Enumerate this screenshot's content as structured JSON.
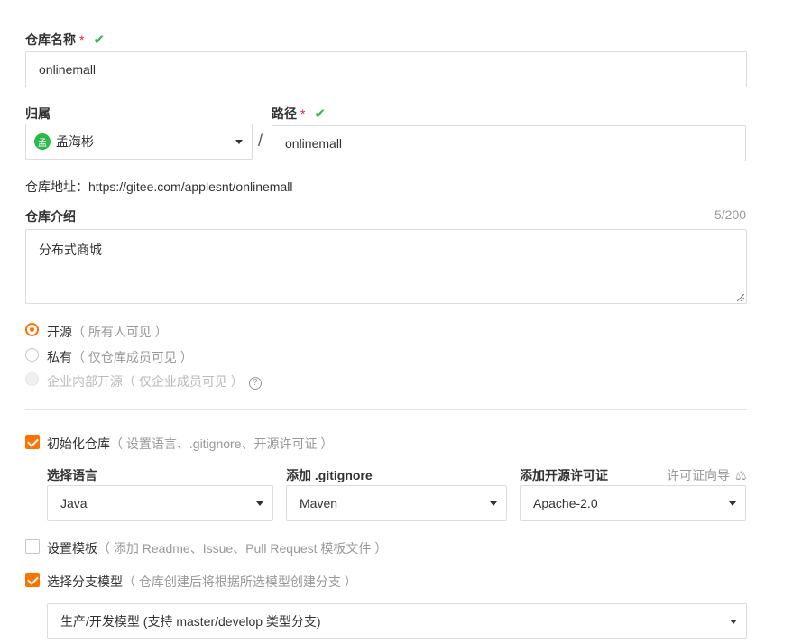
{
  "repo_name": {
    "label": "仓库名称",
    "required_mark": "*",
    "check_glyph": "✔",
    "value": "onlinemall"
  },
  "owner": {
    "label": "归属",
    "avatar_text": "孟",
    "value": "孟海彬"
  },
  "slash": "/",
  "path": {
    "label": "路径",
    "required_mark": "*",
    "check_glyph": "✔",
    "value": "onlinemall"
  },
  "repo_address": "仓库地址：https://gitee.com/applesnt/onlinemall",
  "description": {
    "label": "仓库介绍",
    "counter": "5/200",
    "value": "分布式商城"
  },
  "visibility": {
    "options": [
      {
        "label": "开源",
        "hint": "（ 所有人可见 ）",
        "checked": true
      },
      {
        "label": "私有",
        "hint": "（ 仅仓库成员可见 ）",
        "checked": false
      },
      {
        "label": "企业内部开源",
        "hint": "（ 仅企业成员可见 ）",
        "disabled": true
      }
    ],
    "help_icon": "question-circle-icon",
    "help_glyph": "?"
  },
  "init_repo": {
    "label": "初始化仓库",
    "hint": "（ 设置语言、.gitignore、开源许可证 ）",
    "checked": true
  },
  "language": {
    "label": "选择语言",
    "value": "Java"
  },
  "gitignore": {
    "label": "添加 .gitignore",
    "value": "Maven"
  },
  "license": {
    "label": "添加开源许可证",
    "wizard_link": "许可证向导",
    "wizard_icon": "scale-icon",
    "wizard_glyph": "⚖",
    "value": "Apache-2.0"
  },
  "template": {
    "label": "设置模板",
    "hint": "（ 添加 Readme、Issue、Pull Request 模板文件 ）",
    "checked": false
  },
  "branch_model": {
    "label": "选择分支模型",
    "hint": "（ 仓库创建后将根据所选模型创建分支 ）",
    "checked": true,
    "value": "生产/开发模型 (支持 master/develop 类型分支)"
  },
  "colors": {
    "accent": "#fe7300",
    "success": "#2db84d",
    "required": "#e7223e"
  }
}
